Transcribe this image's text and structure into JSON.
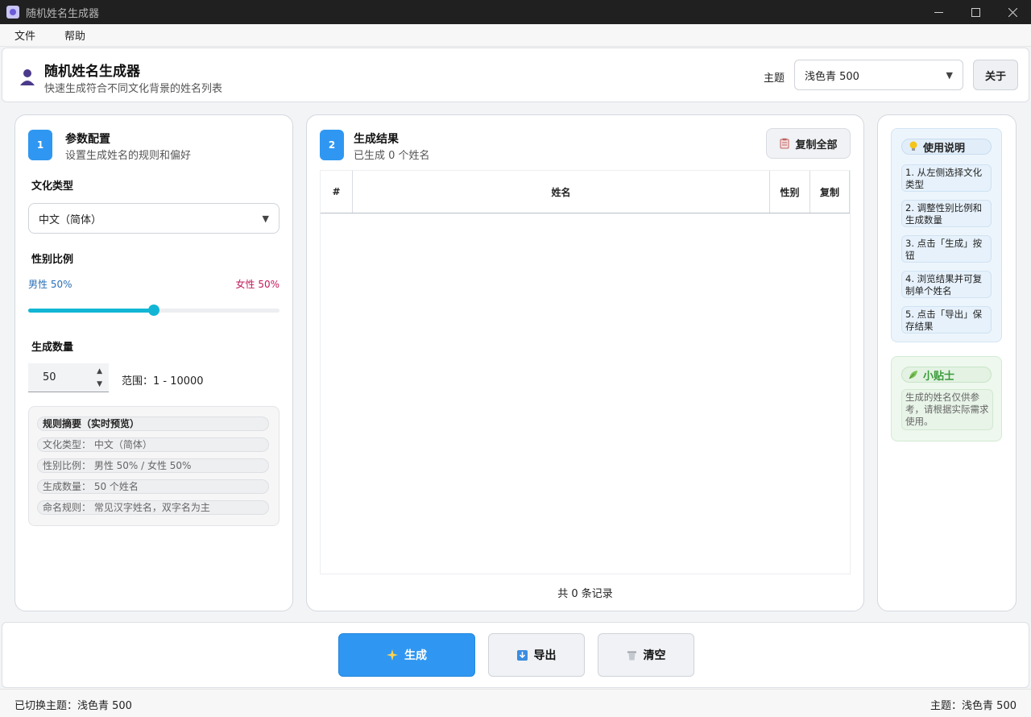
{
  "window": {
    "title": "随机姓名生成器"
  },
  "menu": [
    "文件",
    "帮助"
  ],
  "header": {
    "title": "随机姓名生成器",
    "subtitle": "快速生成符合不同文化背景的姓名列表",
    "theme_label": "主题",
    "theme_value": "浅色青 500",
    "about_label": "关于"
  },
  "config": {
    "step": "1",
    "title": "参数配置",
    "subtitle": "设置生成姓名的规则和偏好",
    "culture_label": "文化类型",
    "culture_value": "中文（简体）",
    "gender_label": "性别比例",
    "male_text": "男性 50%",
    "female_text": "女性 50%",
    "male_ratio": 0.5,
    "count_label": "生成数量",
    "count_value": "50",
    "range_text": "范围：1 - 10000",
    "summary_title": "规则摘要（实时预览）",
    "summary_rows": [
      "文化类型：  中文（简体）",
      "性别比例：  男性 50% / 女性 50%",
      "生成数量：  50 个姓名",
      "命名规则：  常见汉字姓名，双字名为主"
    ]
  },
  "results": {
    "step": "2",
    "title": "生成结果",
    "subtitle": "已生成 0 个姓名",
    "copy_all_label": "复制全部",
    "columns": [
      "#",
      "姓名",
      "性别",
      "复制"
    ],
    "footer": "共 0 条记录"
  },
  "help": {
    "title": "使用说明",
    "steps": [
      "1. 从左侧选择文化类型",
      "2. 调整性别比例和生成数量",
      "3. 点击「生成」按钮",
      "4. 浏览结果并可复制单个姓名",
      "5. 点击「导出」保存结果"
    ],
    "tip_title": "小贴士",
    "tip_text": "生成的姓名仅供参考，请根据实际需求使用。"
  },
  "actions": {
    "generate": "生成",
    "export": "导出",
    "clear": "清空"
  },
  "status": {
    "left": "已切换主题：浅色青 500",
    "right": "主题：浅色青 500"
  },
  "colors": {
    "accent": "#2f97f2",
    "slider": "#12b6d4",
    "male": "#2a6fb8",
    "female": "#c2185b"
  }
}
